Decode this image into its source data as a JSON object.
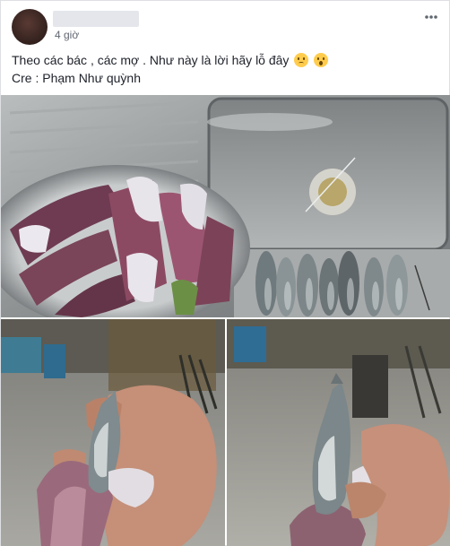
{
  "post": {
    "author_redacted": "",
    "time": "4 giờ",
    "more_icon": "more-horizontal-icon",
    "caption_line1": "Theo các bác , các mợ . Như này là lời hãy lỗ đây",
    "caption_line2": "Cre : Phạm Như quỳnh",
    "emojis": [
      "disappointed-face-icon",
      "astonished-face-icon"
    ]
  },
  "photos": [
    {
      "name": "photo-squid-plate-sink-fish"
    },
    {
      "name": "photo-squid-held-with-fish"
    },
    {
      "name": "photo-fish-in-squid-closeup"
    }
  ]
}
